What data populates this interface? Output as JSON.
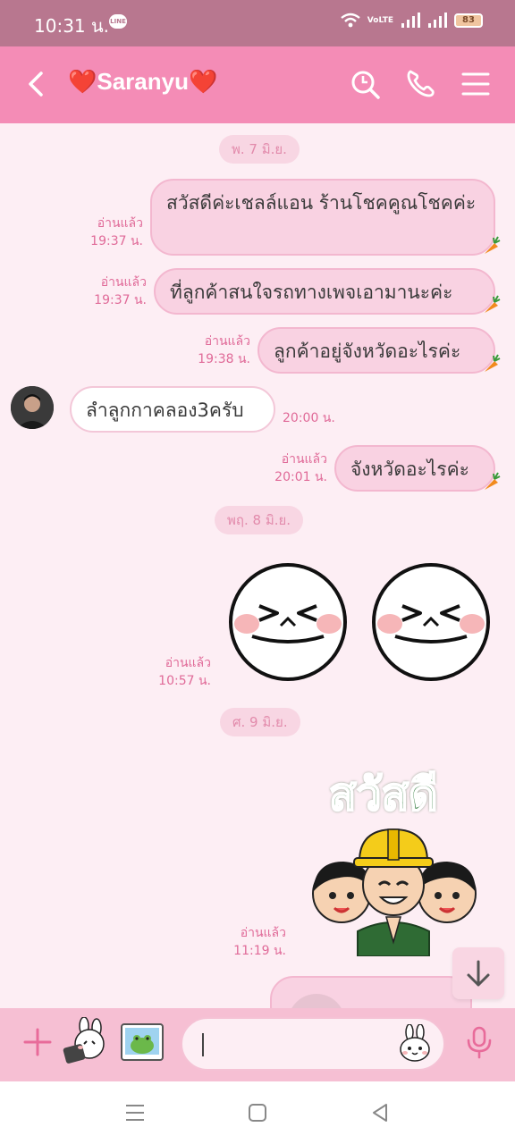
{
  "status_bar": {
    "time": "10:31 น.",
    "line_badge": "LINE",
    "volte": "VoLTE",
    "battery": "83"
  },
  "header": {
    "title": "❤️Saranyu❤️"
  },
  "chat": {
    "dates": [
      "พ. 7 มิ.ย.",
      "พฤ. 8 มิ.ย.",
      "ศ. 9 มิ.ย."
    ],
    "messages": [
      {
        "side": "out",
        "text": "สวัสดีค่ะเชลล์แอน ร้านโชคคูณโชคค่ะ",
        "read": "อ่านแล้ว",
        "time": "19:37 น."
      },
      {
        "side": "out",
        "text": "ที่ลูกค้าสนใจรถทางเพจเอามานะค่ะ",
        "read": "อ่านแล้ว",
        "time": "19:37 น."
      },
      {
        "side": "out",
        "text": "ลูกค้าอยู่จังหวัดอะไรค่ะ",
        "read": "อ่านแล้ว",
        "time": "19:38 น."
      },
      {
        "side": "in",
        "text": "ลำลูกกาคลอง3ครับ",
        "time": "20:00 น."
      },
      {
        "side": "out",
        "text": "จังหวัดอะไรค่ะ",
        "read": "อ่านแล้ว",
        "time": "20:01 น."
      }
    ],
    "sticker1": {
      "read": "อ่านแล้ว",
      "time": "10:57 น."
    },
    "sticker2": {
      "text": "สวัสดี",
      "read": "อ่านแล้ว",
      "time": "11:19 น."
    }
  },
  "colors": {
    "header": "#f48cb6",
    "status": "#b8778f",
    "bubble_out": "#f9d2e2",
    "meta": "#e06a98"
  },
  "icons": [
    "back-arrow-icon",
    "search-icon",
    "phone-icon",
    "menu-icon",
    "plus-icon",
    "mic-icon",
    "scroll-down-icon"
  ]
}
